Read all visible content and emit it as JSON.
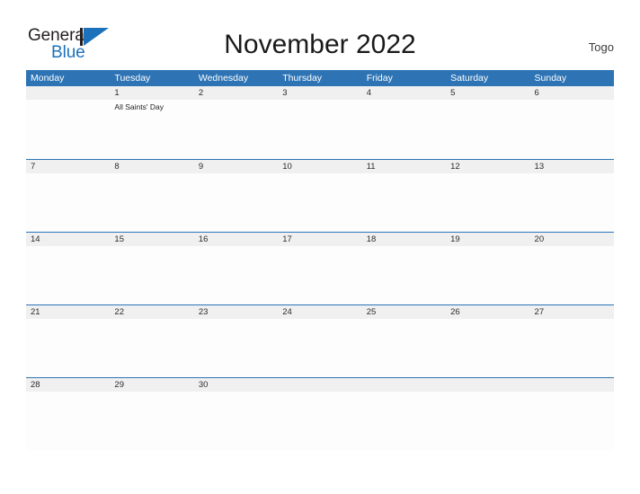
{
  "brand": {
    "name_part1": "General",
    "name_part2": "Blue",
    "mark_icon": "triangle-flag-icon",
    "color_primary": "#1b72bb",
    "color_dark": "#231f20"
  },
  "header": {
    "title": "November 2022",
    "region": "Togo"
  },
  "theme": {
    "header_blue": "#2e74b5",
    "date_band_gray": "#f0f0f0",
    "page_background": "#ffffff",
    "cell_background": "#fdfdfd",
    "text_dark": "#1a1a1a"
  },
  "calendar": {
    "month": "November",
    "year": "2022",
    "first_day_of_week": "Monday",
    "weekdays": [
      "Monday",
      "Tuesday",
      "Wednesday",
      "Thursday",
      "Friday",
      "Saturday",
      "Sunday"
    ],
    "weeks": [
      {
        "days": [
          {
            "date": "",
            "events": []
          },
          {
            "date": "1",
            "events": [
              "All Saints' Day"
            ]
          },
          {
            "date": "2",
            "events": []
          },
          {
            "date": "3",
            "events": []
          },
          {
            "date": "4",
            "events": []
          },
          {
            "date": "5",
            "events": []
          },
          {
            "date": "6",
            "events": []
          }
        ]
      },
      {
        "days": [
          {
            "date": "7",
            "events": []
          },
          {
            "date": "8",
            "events": []
          },
          {
            "date": "9",
            "events": []
          },
          {
            "date": "10",
            "events": []
          },
          {
            "date": "11",
            "events": []
          },
          {
            "date": "12",
            "events": []
          },
          {
            "date": "13",
            "events": []
          }
        ]
      },
      {
        "days": [
          {
            "date": "14",
            "events": []
          },
          {
            "date": "15",
            "events": []
          },
          {
            "date": "16",
            "events": []
          },
          {
            "date": "17",
            "events": []
          },
          {
            "date": "18",
            "events": []
          },
          {
            "date": "19",
            "events": []
          },
          {
            "date": "20",
            "events": []
          }
        ]
      },
      {
        "days": [
          {
            "date": "21",
            "events": []
          },
          {
            "date": "22",
            "events": []
          },
          {
            "date": "23",
            "events": []
          },
          {
            "date": "24",
            "events": []
          },
          {
            "date": "25",
            "events": []
          },
          {
            "date": "26",
            "events": []
          },
          {
            "date": "27",
            "events": []
          }
        ]
      },
      {
        "days": [
          {
            "date": "28",
            "events": []
          },
          {
            "date": "29",
            "events": []
          },
          {
            "date": "30",
            "events": []
          },
          {
            "date": "",
            "events": []
          },
          {
            "date": "",
            "events": []
          },
          {
            "date": "",
            "events": []
          },
          {
            "date": "",
            "events": []
          }
        ]
      }
    ]
  }
}
